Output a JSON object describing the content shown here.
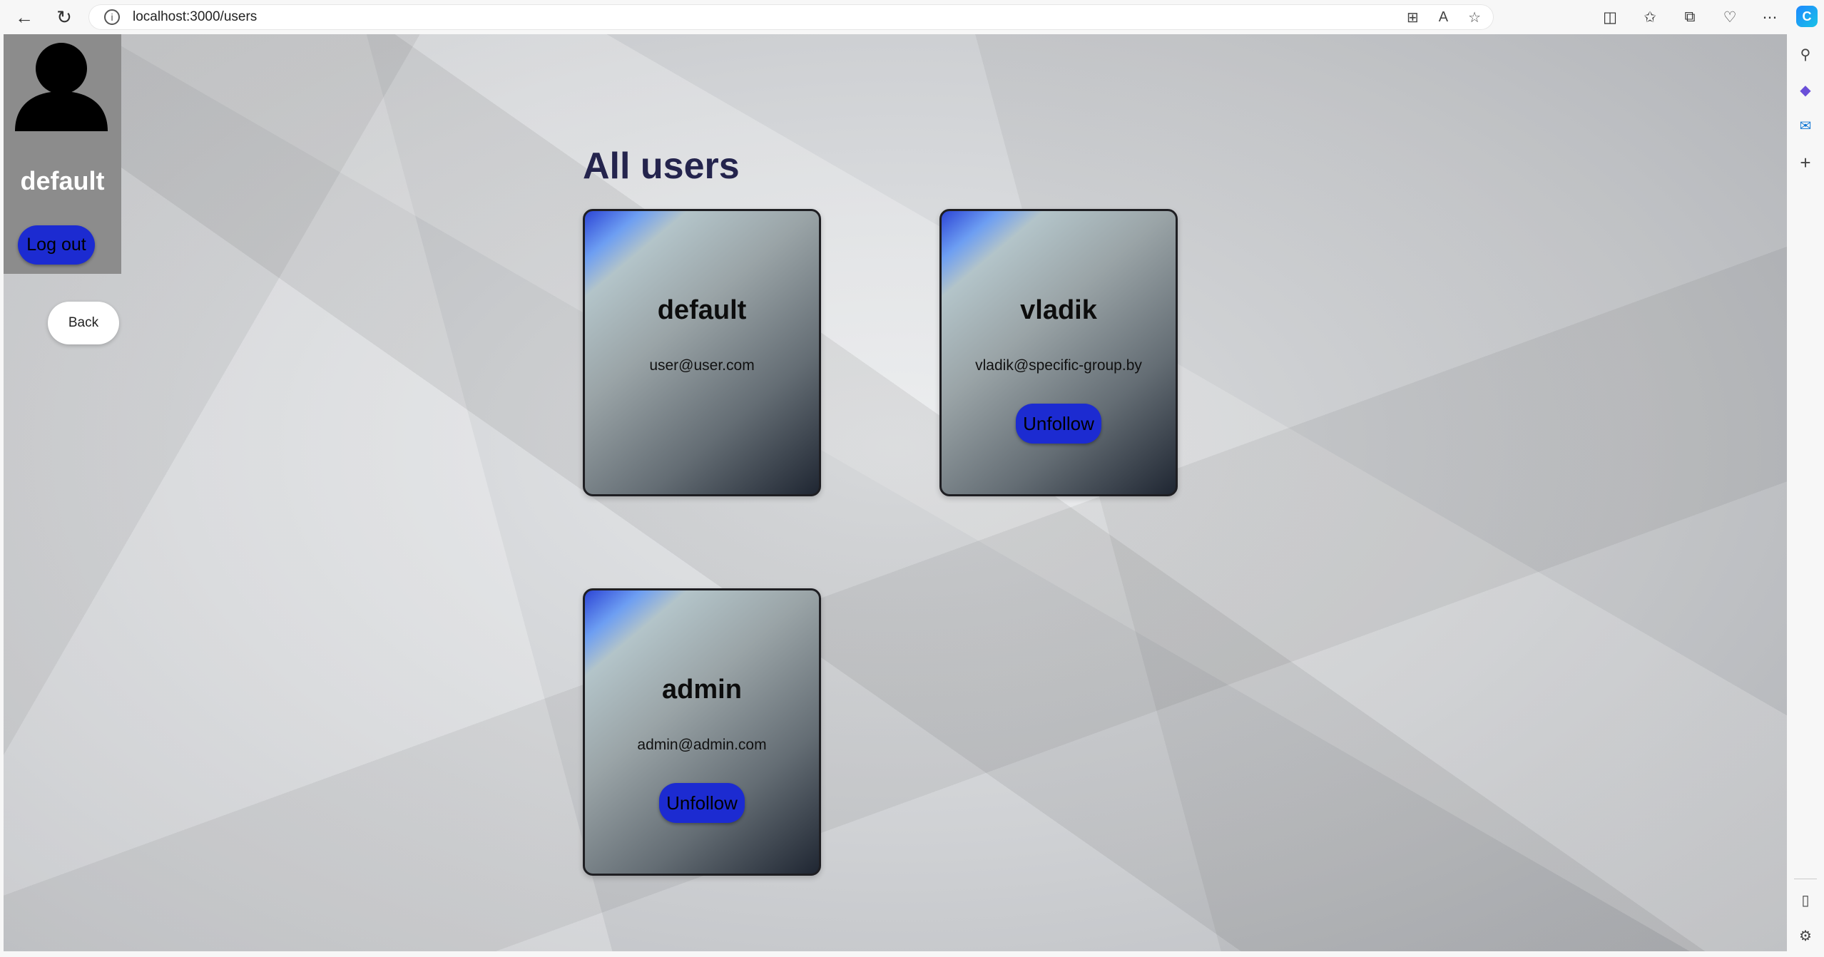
{
  "browser": {
    "url": "localhost:3000/users",
    "icons": {
      "back": "arrow-left-icon",
      "reload": "reload-icon",
      "info": "info-icon",
      "apps": "apps-icon",
      "read_aloud": "read-aloud-icon",
      "favorite": "star-icon",
      "split": "split-screen-icon",
      "favorites": "favorites-icon",
      "collections": "collections-icon",
      "browser_essentials": "heart-pulse-icon",
      "more": "more-icon",
      "copilot": "copilot-icon"
    }
  },
  "edge_sidebar": {
    "icons": [
      "search-icon",
      "copilot-apps-icon",
      "outlook-icon",
      "add-icon",
      "sidebar-toggle-icon",
      "settings-icon"
    ]
  },
  "profile": {
    "name": "default",
    "logout_label": "Log out"
  },
  "back_label": "Back",
  "page_title": "All users",
  "users": [
    {
      "name": "default",
      "email": "user@user.com",
      "action": ""
    },
    {
      "name": "vladik",
      "email": "vladik@specific-group.by",
      "action": "Unfollow"
    },
    {
      "name": "admin",
      "email": "admin@admin.com",
      "action": "Unfollow"
    }
  ],
  "colors": {
    "button_blue": "#1c2bd1",
    "title_color": "#24244d",
    "panel_gray": "#8c8c8c"
  }
}
